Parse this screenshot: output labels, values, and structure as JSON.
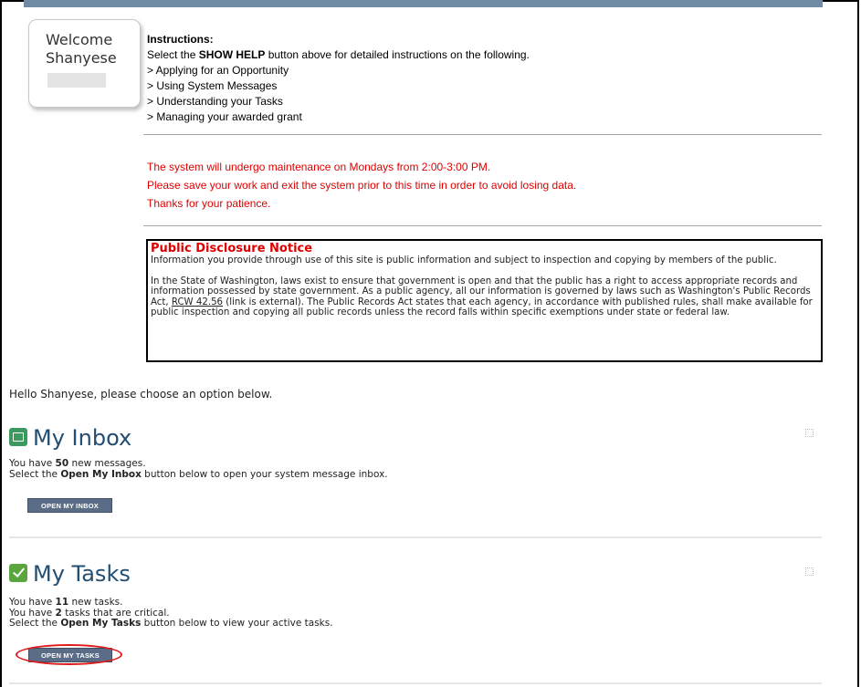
{
  "welcome": {
    "line1": "Welcome",
    "line2": "Shanyese"
  },
  "instructions": {
    "heading": "Instructions:",
    "line1_pre": "Select the ",
    "line1_bold": "SHOW HELP",
    "line1_post": " button above for detailed instructions on the following.",
    "items": [
      "> Applying for an Opportunity",
      "> Using System Messages",
      "> Understanding your Tasks",
      "> Managing your awarded grant"
    ]
  },
  "maintenance": [
    "The system will undergo maintenance on Mondays from 2:00-3:00 PM.",
    "Please save your work and exit the system prior to this time in order to avoid losing data.",
    "Thanks for your patience."
  ],
  "notice": {
    "title": "Public Disclosure Notice",
    "para1": "Information you provide through use of this site is public information and subject to inspection and copying by members of the public.",
    "para2_pre": "In the State of Washington, laws exist to ensure that government is open and that the public has a right to access appropriate records and information possessed by state government. As a public agency, all our information is governed by laws such as Washington's Public Records Act, ",
    "link": "RCW 42.56",
    "para2_post": " (link is external). The Public Records Act states that each agency, in accordance with published rules, shall make available for public inspection and copying all public records unless the record falls within specific exemptions under state or federal law."
  },
  "hello": "Hello Shanyese, please choose an option below.",
  "inbox": {
    "title": "My Inbox",
    "line1_pre": "You have ",
    "line1_num": "50",
    "line1_post": " new messages.",
    "line2_pre": "Select the ",
    "line2_bold": "Open My Inbox",
    "line2_post": " button below to open your system message inbox.",
    "button": "OPEN MY INBOX"
  },
  "tasks": {
    "title": "My Tasks",
    "line1_pre": "You have ",
    "line1_num": "11",
    "line1_post": " new tasks.",
    "line2_pre": "You have ",
    "line2_num": "2",
    "line2_post": " tasks that are critical.",
    "line3_pre": "Select the ",
    "line3_bold": "Open My Tasks",
    "line3_post": " button below to view your active tasks.",
    "button": "OPEN MY TASKS"
  },
  "colors": {
    "topbar": "#6f8ba4",
    "alert_red": "#e00000",
    "title_blue": "#234e71",
    "button_bg": "#5b6d86",
    "highlight_ring": "#e01a1a"
  },
  "icons": {
    "inbox": "envelope-icon",
    "tasks": "checkmark-icon",
    "drag": "drag-handle-icon"
  }
}
